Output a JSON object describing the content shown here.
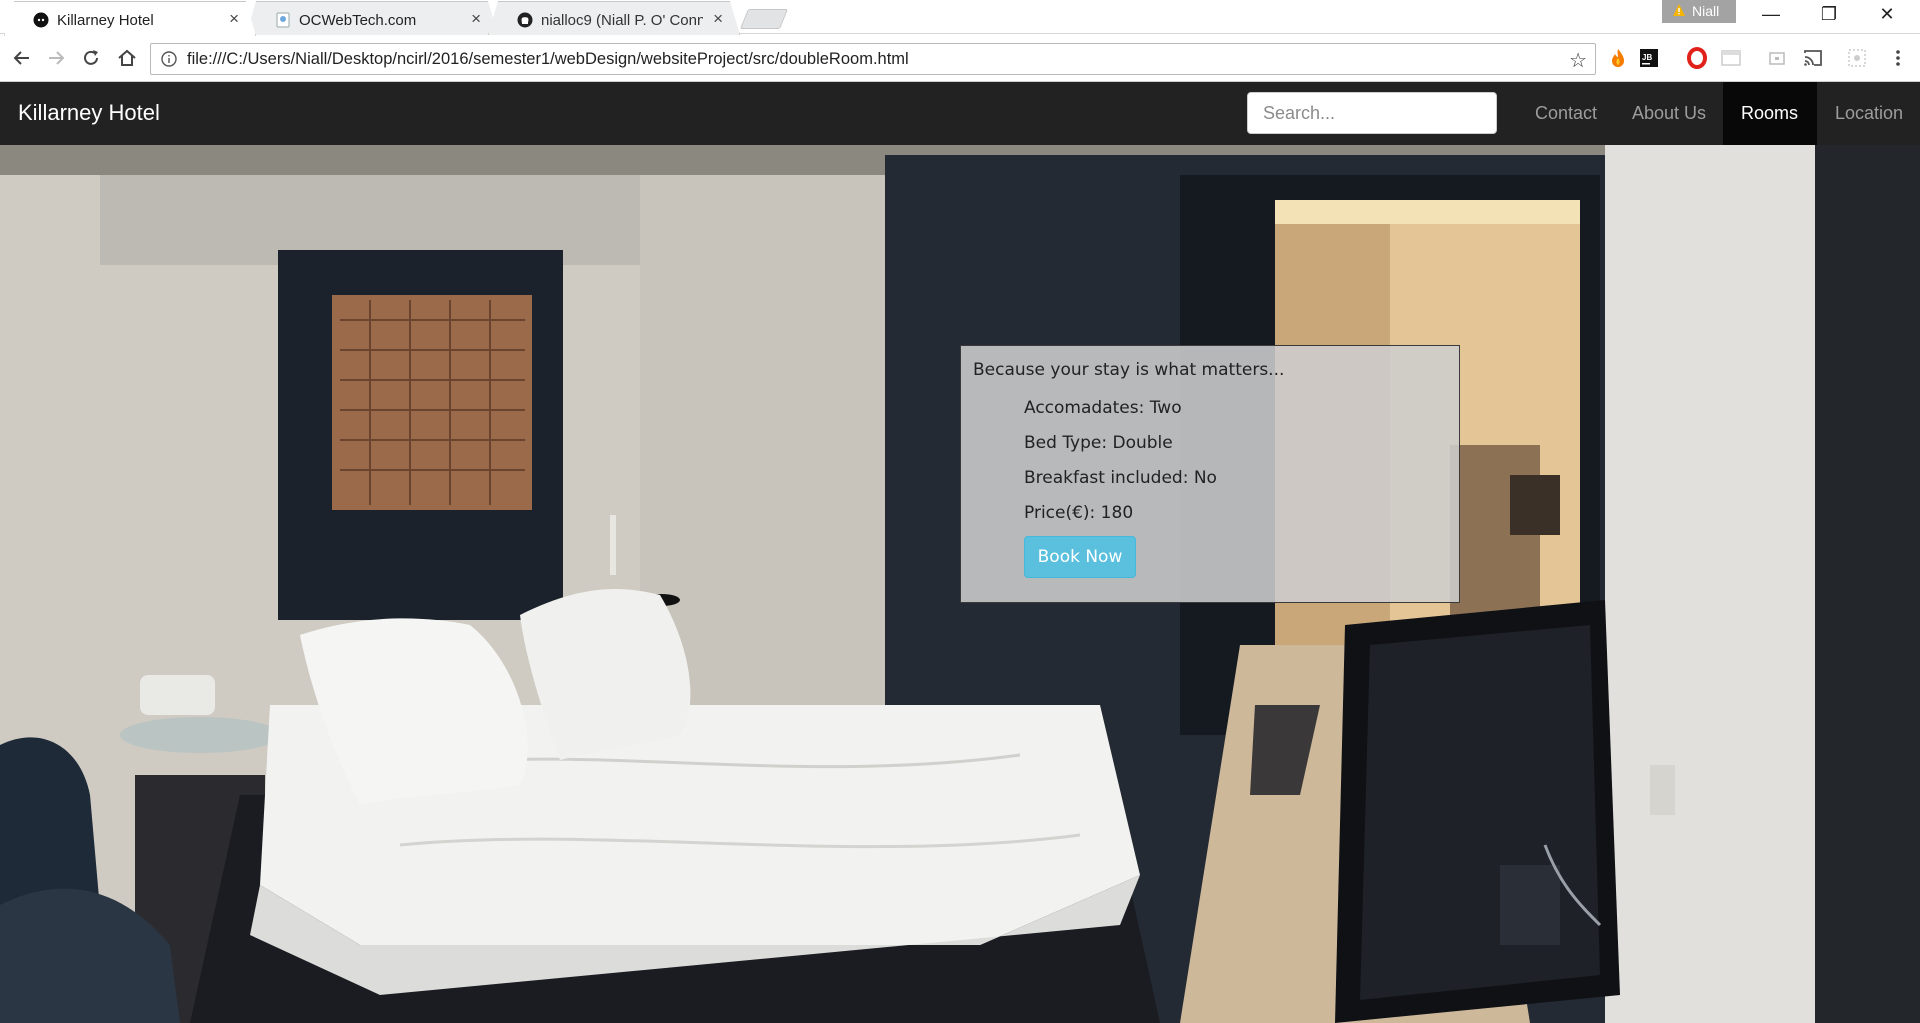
{
  "browser": {
    "tabs": [
      {
        "title": "Killarney Hotel",
        "active": true
      },
      {
        "title": "OCWebTech.com",
        "active": false
      },
      {
        "title": "nialloc9 (Niall P. O' Conn",
        "active": false
      }
    ],
    "profile_name": "Niall",
    "url": "file:///C:/Users/Niall/Desktop/ncirl/2016/semester1/webDesign/websiteProject/src/doubleRoom.html",
    "window_controls": {
      "minimize": "—",
      "restore": "❐",
      "close": "✕"
    },
    "tab_close_glyph": "×",
    "star_glyph": "☆"
  },
  "site": {
    "brand": "Killarney Hotel",
    "search_placeholder": "Search...",
    "nav": [
      {
        "label": "Contact",
        "active": false
      },
      {
        "label": "About Us",
        "active": false
      },
      {
        "label": "Rooms",
        "active": true
      },
      {
        "label": "Location",
        "active": false
      }
    ]
  },
  "room": {
    "tagline": "Because your stay is what matters...",
    "details": [
      "Accomadates: Two",
      "Bed Type: Double",
      "Breakfast included: No",
      "Price(€): 180"
    ],
    "book_label": "Book Now"
  },
  "colors": {
    "navbar_bg": "#222222",
    "nav_active_bg": "#080808",
    "book_button": "#5bc0de"
  }
}
